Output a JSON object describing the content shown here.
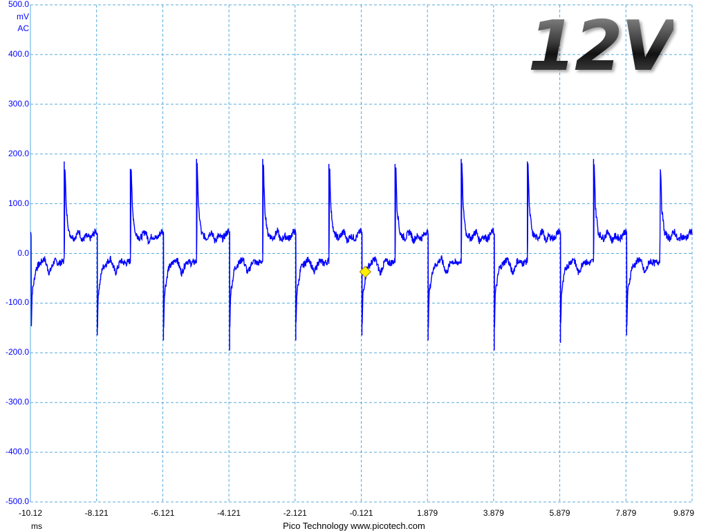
{
  "overlay_title": "12V",
  "footer": "Pico Technology  www.picotech.com",
  "colors": {
    "trace": "#0000ff",
    "grid": "#55aadd",
    "trigger": "#ffee00",
    "axis_text": "#0000ff"
  },
  "chart_data": {
    "type": "line",
    "y_unit": "mV",
    "y_coupling": "AC",
    "x_unit": "ms",
    "ylim": [
      -500,
      500
    ],
    "xlim": [
      -10.121,
      9.879
    ],
    "y_ticks": [
      "500.0",
      "400.0",
      "300.0",
      "200.0",
      "100.0",
      "0.0",
      "-100.0",
      "-200.0",
      "-300.0",
      "-400.0",
      "-500.0"
    ],
    "x_ticks": [
      "-10.12",
      "-8.121",
      "-6.121",
      "-4.121",
      "-2.121",
      "-0.121",
      "1.879",
      "3.879",
      "5.879",
      "7.879",
      "9.879"
    ],
    "grid": true,
    "trigger": {
      "x": 0.0,
      "y": -37
    },
    "period_ms": 2.0,
    "pulse_times_ms": [
      -8.1,
      -6.1,
      -4.1,
      -2.1,
      -0.1,
      1.9,
      3.9,
      5.9,
      7.9
    ],
    "pulse_peaks_mV": [
      185,
      185,
      170,
      190,
      190,
      180,
      180,
      190,
      185,
      190
    ],
    "pulse_dips_mV": [
      -165,
      -175,
      -195,
      -175,
      -165,
      -175,
      -195,
      -180,
      -165,
      -175
    ],
    "cycle_waveform": {
      "x_offset_ms": [
        0.0,
        0.02,
        0.06,
        0.15,
        0.3,
        0.45,
        0.55,
        0.65,
        0.8,
        0.95,
        1.0
      ],
      "y_mV": [
        -100,
        190,
        90,
        40,
        30,
        45,
        25,
        35,
        30,
        45,
        40
      ]
    },
    "low_phase": {
      "x_offset_ms": [
        0.0,
        0.03,
        0.15,
        0.4,
        0.55,
        0.7,
        0.85,
        1.0
      ],
      "y_mV": [
        -170,
        -80,
        -30,
        -10,
        -40,
        -15,
        -20,
        -15
      ]
    }
  }
}
